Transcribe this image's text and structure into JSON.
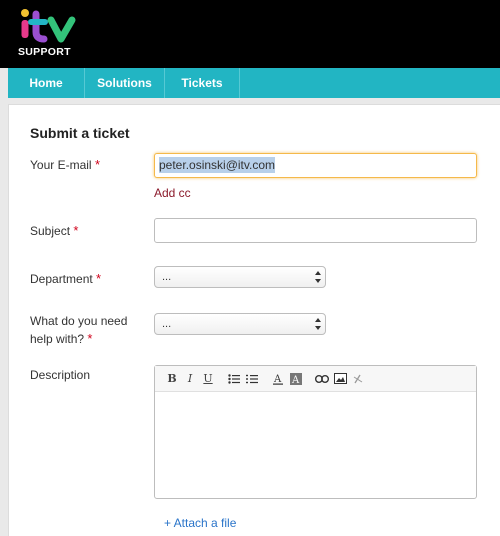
{
  "brand": {
    "logo_text": "itv",
    "sub_label": "SUPPORT"
  },
  "nav": {
    "items": [
      {
        "label": "Home"
      },
      {
        "label": "Solutions"
      },
      {
        "label": "Tickets"
      }
    ]
  },
  "form": {
    "title": "Submit a ticket",
    "email": {
      "label": "Your E-mail",
      "required_mark": "*",
      "value": "peter.osinski@itv.com"
    },
    "add_cc": "Add cc",
    "subject": {
      "label": "Subject",
      "required_mark": "*",
      "value": ""
    },
    "department": {
      "label": "Department",
      "required_mark": "*",
      "selected": "..."
    },
    "help": {
      "label_line1": "What do you need",
      "label_line2": "help with?",
      "required_mark": "*",
      "selected": "..."
    },
    "description": {
      "label": "Description",
      "value": ""
    },
    "attach_label": "+ Attach a file"
  },
  "editor_toolbar": [
    "bold-icon",
    "italic-icon",
    "underline-icon",
    "bullet-list-icon",
    "numbered-list-icon",
    "font-color-icon",
    "background-color-icon",
    "link-icon",
    "image-icon",
    "remove-format-icon"
  ],
  "colors": {
    "header_bg": "#000000",
    "nav_bg": "#22b5c3",
    "required": "#d0021b",
    "add_cc": "#8b1a2b",
    "attach_link": "#2a74c9",
    "email_focus": "#f5b94a"
  }
}
